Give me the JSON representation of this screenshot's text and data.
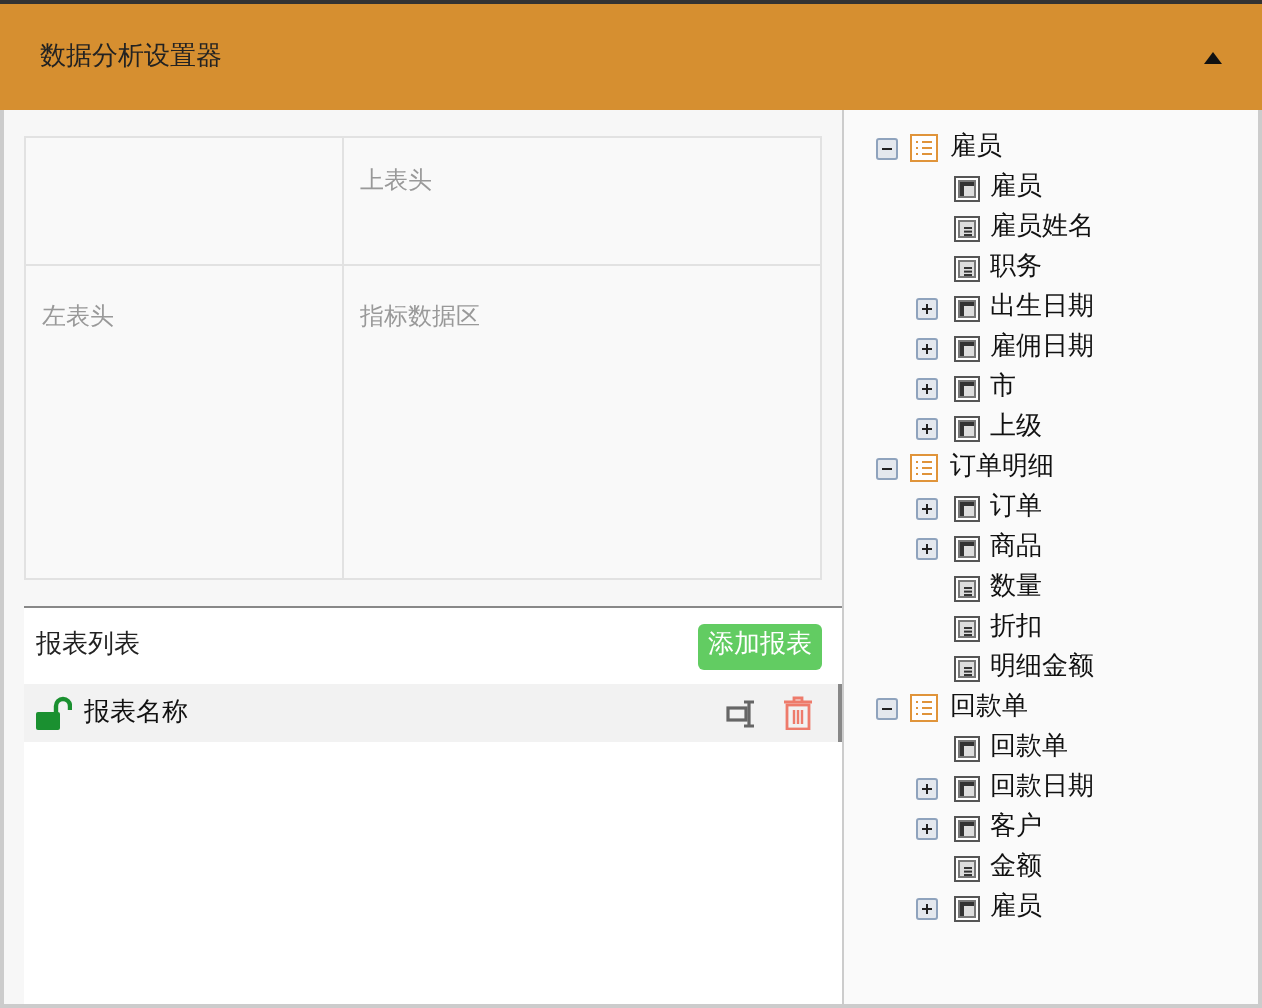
{
  "header": {
    "title": "数据分析设置器",
    "collapsed": false
  },
  "pivot": {
    "top_header": "上表头",
    "left_header": "左表头",
    "data_area": "指标数据区"
  },
  "report_list": {
    "title": "报表列表",
    "add_button": "添加报表",
    "reports": [
      {
        "name": "报表名称",
        "locked": false,
        "selected": true
      }
    ]
  },
  "tree": [
    {
      "label": "雇员",
      "expanded": true,
      "children": [
        {
          "label": "雇员",
          "kind": "dimension",
          "has_children": false
        },
        {
          "label": "雇员姓名",
          "kind": "measure",
          "has_children": false
        },
        {
          "label": "职务",
          "kind": "measure",
          "has_children": false
        },
        {
          "label": "出生日期",
          "kind": "dimension",
          "has_children": true
        },
        {
          "label": "雇佣日期",
          "kind": "dimension",
          "has_children": true
        },
        {
          "label": "市",
          "kind": "dimension",
          "has_children": true
        },
        {
          "label": "上级",
          "kind": "dimension",
          "has_children": true
        }
      ]
    },
    {
      "label": "订单明细",
      "expanded": true,
      "children": [
        {
          "label": "订单",
          "kind": "dimension",
          "has_children": true
        },
        {
          "label": "商品",
          "kind": "dimension",
          "has_children": true
        },
        {
          "label": "数量",
          "kind": "measure",
          "has_children": false
        },
        {
          "label": "折扣",
          "kind": "measure",
          "has_children": false
        },
        {
          "label": "明细金额",
          "kind": "measure",
          "has_children": false
        }
      ]
    },
    {
      "label": "回款单",
      "expanded": true,
      "children": [
        {
          "label": "回款单",
          "kind": "dimension",
          "has_children": false
        },
        {
          "label": "回款日期",
          "kind": "dimension",
          "has_children": true
        },
        {
          "label": "客户",
          "kind": "dimension",
          "has_children": true
        },
        {
          "label": "金额",
          "kind": "measure",
          "has_children": false
        },
        {
          "label": "雇员",
          "kind": "dimension",
          "has_children": true
        }
      ]
    }
  ]
}
